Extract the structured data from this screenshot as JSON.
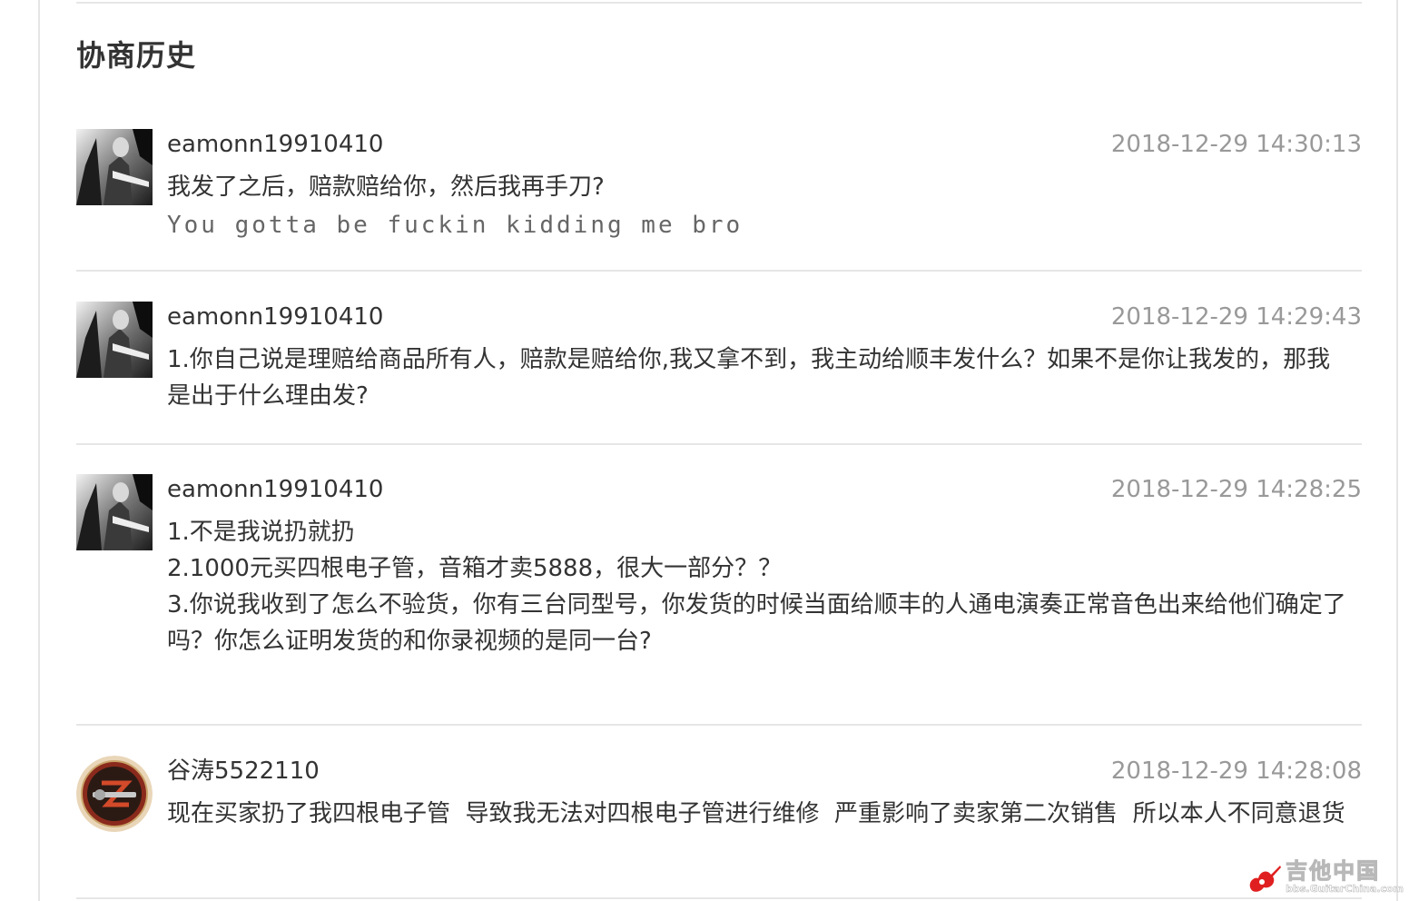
{
  "page": {
    "title": "协商历史"
  },
  "entries": [
    {
      "username": "eamonn19910410",
      "timestamp": "2018-12-29 14:30:13",
      "lines": [
        "我发了之后，赔款赔给你，然后我再手刀?",
        "You gotta be fuckin kidding me bro"
      ]
    },
    {
      "username": "eamonn19910410",
      "timestamp": "2018-12-29 14:29:43",
      "lines": [
        "1.你自己说是理赔给商品所有人，赔款是赔给你,我又拿不到，我主动给顺丰发什么？如果不是你让我发的，那我是出于什么理由发?"
      ]
    },
    {
      "username": "eamonn19910410",
      "timestamp": "2018-12-29 14:28:25",
      "lines": [
        "1.不是我说扔就扔",
        "2.1000元买四根电子管，音箱才卖5888，很大一部分？？",
        "3.你说我收到了怎么不验货，你有三台同型号，你发货的时候当面给顺丰的人通电演奏正常音色出来给他们确定了吗？你怎么证明发货的和你录视频的是同一台?"
      ]
    },
    {
      "username": "谷涛5522110",
      "timestamp": "2018-12-29 14:28:08",
      "lines": [
        "现在买家扔了我四根电子管  导致我无法对四根电子管进行维修  严重影响了卖家第二次销售  所以本人不同意退货"
      ]
    }
  ],
  "watermark": {
    "cn": "吉他中国",
    "en": "bbs.GuitarChina.com"
  },
  "icons": {
    "avatar_photo": "user-photo-avatar",
    "avatar_badge": "shop-badge-avatar",
    "watermark_logo": "guitar-logo-icon"
  },
  "colors": {
    "text": "#333333",
    "muted": "#999999",
    "divider": "#e6e6e6"
  }
}
